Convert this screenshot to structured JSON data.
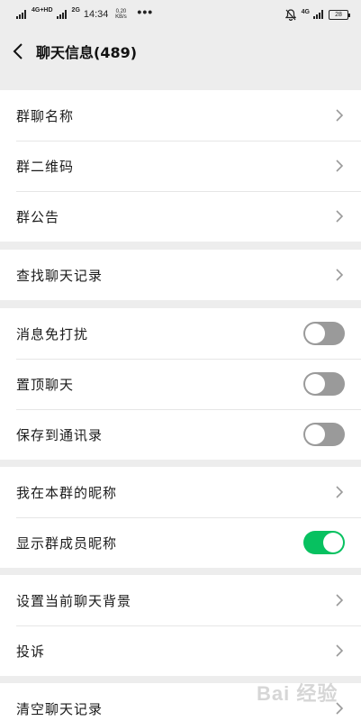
{
  "status_bar": {
    "net1": "4G+HD",
    "net2": "2G",
    "time": "14:34",
    "speed_value": "0.20",
    "speed_unit": "KB/s",
    "dots": "•••",
    "net3": "4G",
    "battery": "28"
  },
  "nav": {
    "title": "聊天信息(489)"
  },
  "group_section": {
    "name_label": "群聊名称",
    "qrcode_label": "群二维码",
    "notice_label": "群公告"
  },
  "search_section": {
    "history_label": "查找聊天记录"
  },
  "settings_section": {
    "mute_label": "消息免打扰",
    "mute_on": false,
    "pin_label": "置顶聊天",
    "pin_on": false,
    "save_label": "保存到通讯录",
    "save_on": false
  },
  "nickname_section": {
    "my_nick_label": "我在本群的昵称",
    "show_nick_label": "显示群成员昵称",
    "show_nick_on": true
  },
  "background_section": {
    "bg_label": "设置当前聊天背景",
    "report_label": "投诉"
  },
  "clear_section": {
    "clear_label": "清空聊天记录"
  },
  "watermark": "Bai 经验",
  "colors": {
    "accent": "#07c160",
    "toggle_off": "#9a9a9a",
    "background": "#ededed"
  }
}
